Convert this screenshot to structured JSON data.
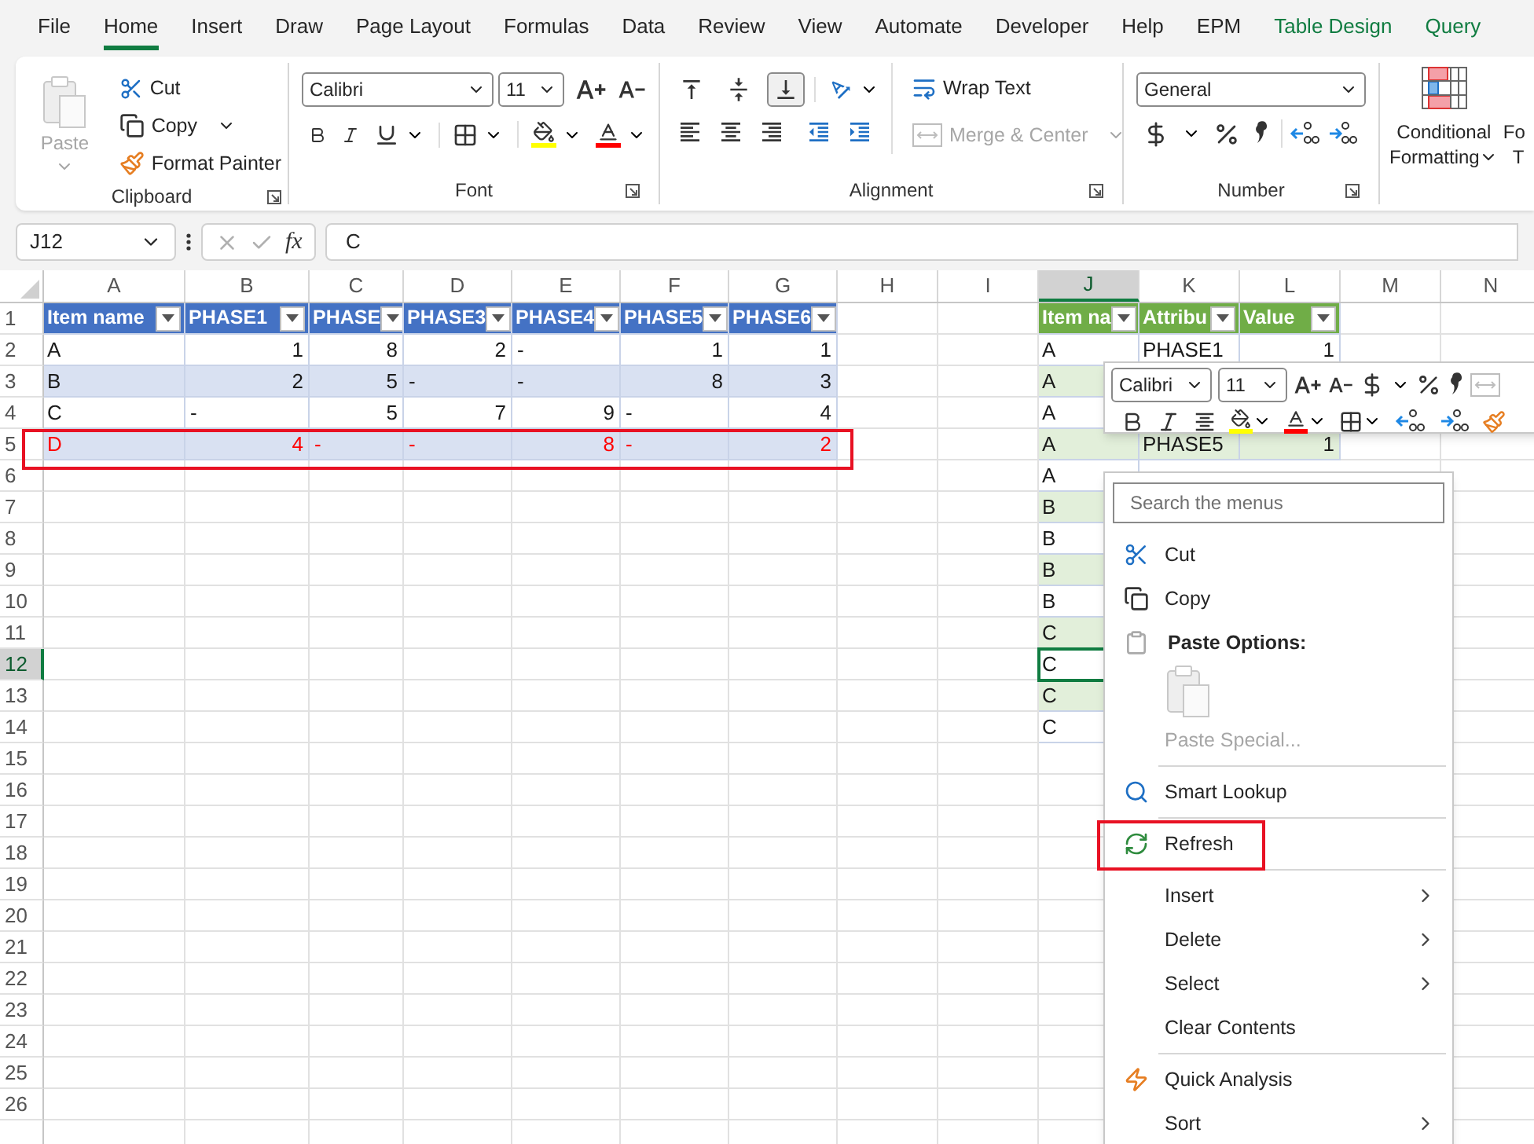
{
  "menu_tabs": [
    {
      "label": "File",
      "selected": false,
      "contextual": false
    },
    {
      "label": "Home",
      "selected": true,
      "contextual": false
    },
    {
      "label": "Insert",
      "selected": false,
      "contextual": false
    },
    {
      "label": "Draw",
      "selected": false,
      "contextual": false
    },
    {
      "label": "Page Layout",
      "selected": false,
      "contextual": false
    },
    {
      "label": "Formulas",
      "selected": false,
      "contextual": false
    },
    {
      "label": "Data",
      "selected": false,
      "contextual": false
    },
    {
      "label": "Review",
      "selected": false,
      "contextual": false
    },
    {
      "label": "View",
      "selected": false,
      "contextual": false
    },
    {
      "label": "Automate",
      "selected": false,
      "contextual": false
    },
    {
      "label": "Developer",
      "selected": false,
      "contextual": false
    },
    {
      "label": "Help",
      "selected": false,
      "contextual": false
    },
    {
      "label": "EPM",
      "selected": false,
      "contextual": false
    },
    {
      "label": "Table Design",
      "selected": false,
      "contextual": true
    },
    {
      "label": "Query",
      "selected": false,
      "contextual": true
    }
  ],
  "ribbon": {
    "clipboard": {
      "label": "Clipboard",
      "paste": {
        "label": "Paste",
        "disabled": true
      },
      "cut": "Cut",
      "copy": "Copy",
      "format_painter": "Format Painter"
    },
    "font": {
      "label": "Font",
      "font_name": "Calibri",
      "font_size": "11"
    },
    "alignment": {
      "label": "Alignment",
      "vertical_alignment": [
        {
          "selected": false
        },
        {
          "selected": false
        },
        {
          "selected": true
        }
      ],
      "wrap_text": "Wrap Text",
      "merge": {
        "label": "Merge & Center",
        "disabled": true
      }
    },
    "number": {
      "label": "Number",
      "format": "General"
    },
    "styles": {
      "conditional_formatting": [
        "Conditional",
        "Formatting"
      ],
      "cut_off_button": [
        "Fo",
        "T"
      ]
    }
  },
  "formula_bar": {
    "name_box": "J12",
    "function_label": "fx",
    "formula": "C"
  },
  "sheet": {
    "columns": [
      {
        "label": "A",
        "selected": false
      },
      {
        "label": "B",
        "selected": false
      },
      {
        "label": "C",
        "selected": false
      },
      {
        "label": "D",
        "selected": false
      },
      {
        "label": "E",
        "selected": false
      },
      {
        "label": "F",
        "selected": false
      },
      {
        "label": "G",
        "selected": false
      },
      {
        "label": "H",
        "selected": false
      },
      {
        "label": "I",
        "selected": false
      },
      {
        "label": "J",
        "selected": true
      },
      {
        "label": "K",
        "selected": false
      },
      {
        "label": "L",
        "selected": false
      },
      {
        "label": "M",
        "selected": false
      },
      {
        "label": "N",
        "selected": false
      }
    ],
    "row_numbers": [
      {
        "label": "1",
        "selected": false
      },
      {
        "label": "2",
        "selected": false
      },
      {
        "label": "3",
        "selected": false
      },
      {
        "label": "4",
        "selected": false
      },
      {
        "label": "5",
        "selected": false
      },
      {
        "label": "6",
        "selected": false
      },
      {
        "label": "7",
        "selected": false
      },
      {
        "label": "8",
        "selected": false
      },
      {
        "label": "9",
        "selected": false
      },
      {
        "label": "10",
        "selected": false
      },
      {
        "label": "11",
        "selected": false
      },
      {
        "label": "12",
        "selected": true
      },
      {
        "label": "13",
        "selected": false
      },
      {
        "label": "14",
        "selected": false
      },
      {
        "label": "15",
        "selected": false
      },
      {
        "label": "16",
        "selected": false
      },
      {
        "label": "17",
        "selected": false
      },
      {
        "label": "18",
        "selected": false
      },
      {
        "label": "19",
        "selected": false
      },
      {
        "label": "20",
        "selected": false
      },
      {
        "label": "21",
        "selected": false
      },
      {
        "label": "22",
        "selected": false
      },
      {
        "label": "23",
        "selected": false
      },
      {
        "label": "24",
        "selected": false
      },
      {
        "label": "25",
        "selected": false
      },
      {
        "label": "26",
        "selected": false
      }
    ],
    "table_1": {
      "columns": [
        "Item name",
        "PHASE1",
        "PHASE",
        "PHASE3",
        "PHASE4",
        "PHASE5",
        "PHASE6"
      ],
      "rows": [
        {
          "highlighted": false,
          "cells": [
            {
              "text": "A",
              "kind": "text"
            },
            {
              "text": "1",
              "kind": "number"
            },
            {
              "text": "8",
              "kind": "number"
            },
            {
              "text": "2",
              "kind": "number"
            },
            {
              "text": "-",
              "kind": "dash"
            },
            {
              "text": "1",
              "kind": "number"
            },
            {
              "text": "1",
              "kind": "number"
            }
          ]
        },
        {
          "highlighted": false,
          "cells": [
            {
              "text": "B",
              "kind": "text"
            },
            {
              "text": "2",
              "kind": "number"
            },
            {
              "text": "5",
              "kind": "number"
            },
            {
              "text": "-",
              "kind": "dash"
            },
            {
              "text": "-",
              "kind": "dash"
            },
            {
              "text": "8",
              "kind": "number"
            },
            {
              "text": "3",
              "kind": "number"
            }
          ]
        },
        {
          "highlighted": false,
          "cells": [
            {
              "text": "C",
              "kind": "text"
            },
            {
              "text": "-",
              "kind": "dash"
            },
            {
              "text": "5",
              "kind": "number"
            },
            {
              "text": "7",
              "kind": "number"
            },
            {
              "text": "9",
              "kind": "number"
            },
            {
              "text": "-",
              "kind": "dash"
            },
            {
              "text": "4",
              "kind": "number"
            }
          ]
        },
        {
          "highlighted": true,
          "cells": [
            {
              "text": "D",
              "kind": "text"
            },
            {
              "text": "4",
              "kind": "number"
            },
            {
              "text": "-",
              "kind": "dash"
            },
            {
              "text": "-",
              "kind": "dash"
            },
            {
              "text": "8",
              "kind": "number"
            },
            {
              "text": "-",
              "kind": "dash"
            },
            {
              "text": "2",
              "kind": "number"
            }
          ]
        }
      ]
    },
    "table_2": {
      "columns": [
        "Item na",
        "Attribu",
        "Value"
      ],
      "rows": [
        {
          "cells": [
            {
              "text": "A",
              "kind": "text"
            },
            {
              "text": "PHASE1",
              "kind": "text"
            },
            {
              "text": "1",
              "kind": "number"
            }
          ]
        },
        {
          "cells": [
            {
              "text": "A",
              "kind": "text"
            }
          ]
        },
        {
          "cells": [
            {
              "text": "A",
              "kind": "text"
            }
          ]
        },
        {
          "cells": [
            {
              "text": "A",
              "kind": "text"
            },
            {
              "text": "PHASE5",
              "kind": "text"
            },
            {
              "text": "1",
              "kind": "number"
            }
          ]
        },
        {
          "cells": [
            {
              "text": "A",
              "kind": "text"
            }
          ]
        },
        {
          "cells": [
            {
              "text": "B",
              "kind": "text"
            }
          ]
        },
        {
          "cells": [
            {
              "text": "B",
              "kind": "text"
            }
          ]
        },
        {
          "cells": [
            {
              "text": "B",
              "kind": "text"
            }
          ]
        },
        {
          "cells": [
            {
              "text": "B",
              "kind": "text"
            }
          ]
        },
        {
          "cells": [
            {
              "text": "C",
              "kind": "text"
            }
          ]
        },
        {
          "cells": [
            {
              "text": "C",
              "kind": "text"
            }
          ]
        },
        {
          "cells": [
            {
              "text": "C",
              "kind": "text"
            }
          ]
        },
        {
          "cells": [
            {
              "text": "C",
              "kind": "text"
            }
          ]
        }
      ]
    }
  },
  "mini_toolbar": {
    "font_name": "Calibri",
    "font_size": "11"
  },
  "context_menu": {
    "search_placeholder": "Search the menus",
    "items": [
      {
        "kind": "command",
        "label": "Cut",
        "disabled": false,
        "submenu": false,
        "highlighted": false
      },
      {
        "kind": "command",
        "label": "Copy",
        "disabled": false,
        "submenu": false,
        "highlighted": false
      },
      {
        "kind": "header",
        "label": "Paste Options:"
      },
      {
        "kind": "paste_choice"
      },
      {
        "kind": "command",
        "label": "Paste Special...",
        "disabled": true,
        "submenu": false,
        "highlighted": false
      },
      {
        "kind": "separator"
      },
      {
        "kind": "command",
        "label": "Smart Lookup",
        "disabled": false,
        "submenu": false,
        "highlighted": false
      },
      {
        "kind": "separator"
      },
      {
        "kind": "command",
        "label": "Refresh",
        "disabled": false,
        "submenu": false,
        "highlighted": true
      },
      {
        "kind": "separator"
      },
      {
        "kind": "command",
        "label": "Insert",
        "disabled": false,
        "submenu": true,
        "highlighted": false
      },
      {
        "kind": "command",
        "label": "Delete",
        "disabled": false,
        "submenu": true,
        "highlighted": false
      },
      {
        "kind": "command",
        "label": "Select",
        "disabled": false,
        "submenu": true,
        "highlighted": false
      },
      {
        "kind": "command",
        "label": "Clear Contents",
        "disabled": false,
        "submenu": false,
        "highlighted": false
      },
      {
        "kind": "separator"
      },
      {
        "kind": "command",
        "label": "Quick Analysis",
        "disabled": false,
        "submenu": false,
        "highlighted": false
      },
      {
        "kind": "command",
        "label": "Sort",
        "disabled": false,
        "submenu": true,
        "highlighted": false
      }
    ]
  }
}
